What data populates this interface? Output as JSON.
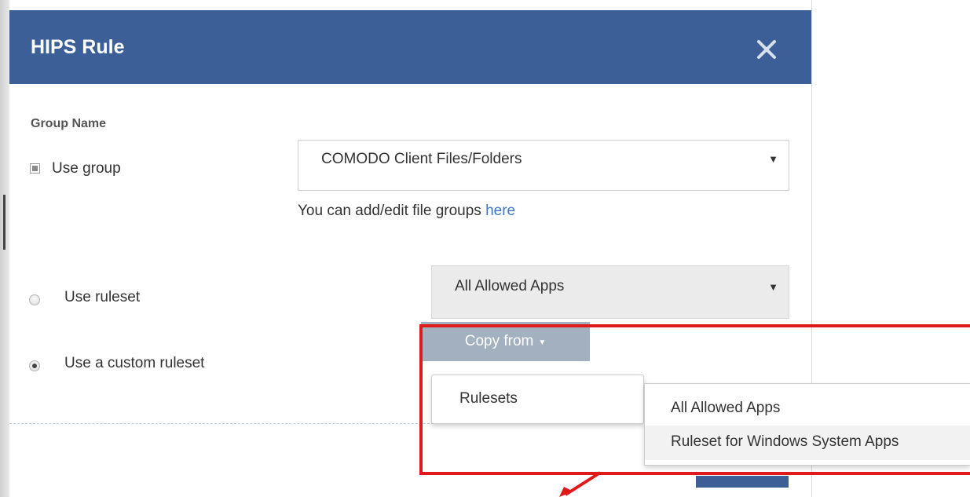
{
  "dialog": {
    "title": "HIPS Rule"
  },
  "group_section": {
    "label": "Group Name",
    "use_group_label": "Use group",
    "use_group_checked": true,
    "group_select_value": "COMODO Client Files/Folders",
    "hint_text": "You can add/edit file groups ",
    "hint_link": "here"
  },
  "ruleset_section": {
    "use_ruleset_label": "Use ruleset",
    "ruleset_select_value": "All Allowed Apps",
    "use_custom_label": "Use a custom ruleset",
    "selected_option": "Use a custom ruleset"
  },
  "copy_from": {
    "button_label": "Copy from",
    "menu_items": [
      "Rulesets"
    ],
    "submenu_items": [
      "All Allowed Apps",
      "Ruleset for Windows System Apps"
    ],
    "hovered_submenu_item": "Ruleset for Windows System Apps"
  },
  "icons": {
    "close": "close-icon",
    "dropdown": "caret-down-icon"
  },
  "colors": {
    "header": "#3c5f98",
    "button": "#a3b0bf",
    "link": "#3b78c6",
    "highlight": "#e01a1a"
  }
}
